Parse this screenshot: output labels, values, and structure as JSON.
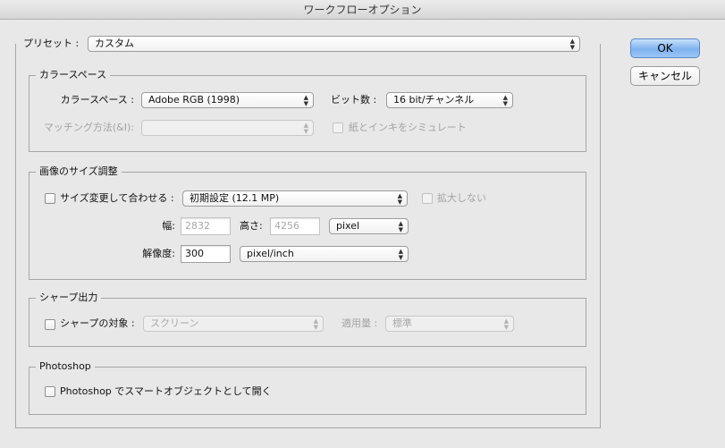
{
  "window": {
    "title": "ワークフローオプション"
  },
  "preset": {
    "label": "プリセット :",
    "value": "カスタム"
  },
  "buttons": {
    "ok": "OK",
    "cancel": "キャンセル"
  },
  "color_space": {
    "legend": "カラースペース",
    "space_label": "カラースペース :",
    "space_value": "Adobe RGB (1998)",
    "bit_label": "ビット数 :",
    "bit_value": "16 bit/チャンネル",
    "matching_label": "マッチング方法(&I):",
    "matching_value": "",
    "simulate_label": "紙とインキをシミュレート"
  },
  "image_size": {
    "legend": "画像のサイズ調整",
    "fit_label": "サイズ変更して合わせる :",
    "fit_value": "初期設定 (12.1 MP)",
    "no_enlarge_label": "拡大しない",
    "width_label": "幅:",
    "width_value": "2832",
    "height_label": "高さ:",
    "height_value": "4256",
    "unit_value": "pixel",
    "resolution_label": "解像度:",
    "resolution_value": "300",
    "resolution_unit": "pixel/inch"
  },
  "sharpen": {
    "legend": "シャープ出力",
    "target_label": "シャープの対象 :",
    "target_value": "スクリーン",
    "amount_label": "適用量 :",
    "amount_value": "標準"
  },
  "photoshop": {
    "legend": "Photoshop",
    "smart_object_label": "Photoshop でスマートオブジェクトとして開く"
  }
}
